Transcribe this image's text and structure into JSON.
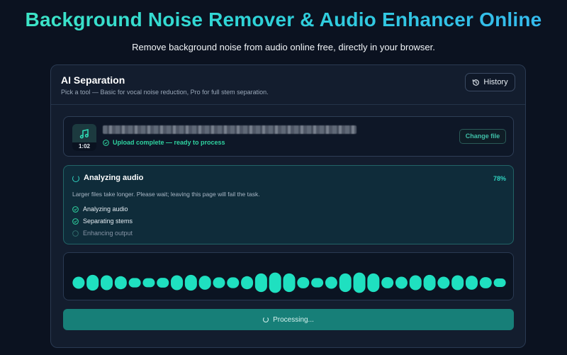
{
  "page": {
    "title": "Background Noise Remover & Audio Enhancer Online",
    "subtitle": "Remove background noise from audio online free, directly in your browser."
  },
  "card": {
    "title": "AI Separation",
    "description": "Pick a tool — Basic for vocal noise reduction, Pro for full stem separation.",
    "history_label": "History"
  },
  "file": {
    "duration": "1:02",
    "status": "Upload complete — ready to process",
    "change_label": "Change file"
  },
  "progress": {
    "title": "Analyzing audio",
    "percent_label": "78%",
    "percent": 78,
    "note": "Larger files take longer. Please wait; leaving this page will fail the task.",
    "steps": [
      {
        "label": "Analyzing audio",
        "state": "done"
      },
      {
        "label": "Separating stems",
        "state": "done"
      },
      {
        "label": "Enhancing output",
        "state": "pending"
      }
    ]
  },
  "waveform": {
    "bar_levels": [
      0.35,
      0.55,
      0.5,
      0.4,
      0.2,
      0.18,
      0.22,
      0.5,
      0.55,
      0.45,
      0.28,
      0.28,
      0.4,
      0.7,
      0.8,
      0.7,
      0.3,
      0.2,
      0.35,
      0.7,
      0.8,
      0.7,
      0.3,
      0.35,
      0.5,
      0.55,
      0.35,
      0.5,
      0.45,
      0.3,
      0.15
    ]
  },
  "action": {
    "processing_label": "Processing..."
  },
  "colors": {
    "accent": "#2fd3c0",
    "wave": "#1fe0c0",
    "button": "#177f78"
  }
}
